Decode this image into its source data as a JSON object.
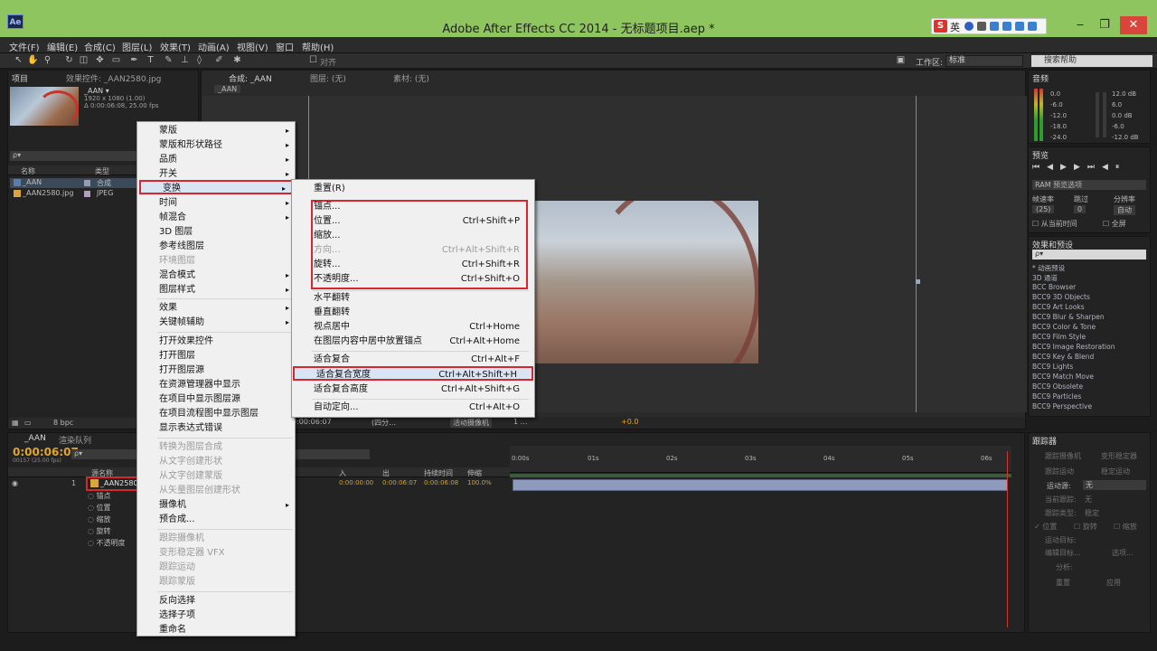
{
  "window": {
    "title": "Adobe After Effects CC 2014 - 无标题项目.aep *",
    "app_icon": "Ae"
  },
  "ime": {
    "logo": "S",
    "lang": "英"
  },
  "menubar": [
    "文件(F)",
    "编辑(E)",
    "合成(C)",
    "图层(L)",
    "效果(T)",
    "动画(A)",
    "视图(V)",
    "窗口",
    "帮助(H)"
  ],
  "toolbar": {
    "align_label": "对齐",
    "workspace_label": "工作区:",
    "workspace_value": "标准",
    "search_placeholder": "搜索帮助"
  },
  "project": {
    "tab_project": "项目",
    "tab_effects": "效果控件: _AAN2580.jpg",
    "comp_name": "_AAN ▾",
    "comp_info1": "1920 x 1080 (1.00)",
    "comp_info2": "Δ 0:00:06:08, 25.00 fps",
    "search": "ρ▾",
    "col_name": "名称",
    "col_type": "类型",
    "items": [
      {
        "name": "_AAN",
        "type": "合成"
      },
      {
        "name": "_AAN2580.jpg",
        "type": "JPEG"
      }
    ],
    "bpc": "8 bpc"
  },
  "comp": {
    "tab": "合成: _AAN",
    "tab_layer": "图层: (无)",
    "tab_footage": "素材: (无)",
    "subtab": "_AAN",
    "footer": {
      "time": "0:00:06:07",
      "view": "(四分…",
      "camera": "活动摄像机",
      "views": "1 …",
      "exposure": "+0.0"
    }
  },
  "audio": {
    "tab": "音频",
    "levels_left": [
      "0.0",
      "-6.0",
      "-12.0",
      "-18.0",
      "-24.0"
    ],
    "levels_right": [
      "12.0 dB",
      "6.0",
      "0.0 dB",
      "-6.0",
      "-12.0 dB"
    ]
  },
  "preview": {
    "tab": "预览",
    "ram": "RAM 预览选项",
    "fps_label": "帧速率",
    "skip_label": "跳过",
    "res_label": "分辨率",
    "fps": "(25)",
    "skip": "0",
    "res": "自动",
    "from_current": "从当前时间",
    "fullscreen": "全屏"
  },
  "effects": {
    "tab": "效果和预设",
    "items": [
      "* 动画预设",
      "3D 通道",
      "BCC Browser",
      "BCC9 3D Objects",
      "BCC9 Art Looks",
      "BCC9 Blur & Sharpen",
      "BCC9 Color & Tone",
      "BCC9 Film Style",
      "BCC9 Image Restoration",
      "BCC9 Key & Blend",
      "BCC9 Lights",
      "BCC9 Match Move",
      "BCC9 Obsolete",
      "BCC9 Particles",
      "BCC9 Perspective"
    ]
  },
  "tracker": {
    "tab": "跟踪器",
    "btn1": "跟踪摄像机",
    "btn2": "变形稳定器",
    "btn3": "跟踪运动",
    "btn4": "稳定运动",
    "source_label": "运动源:",
    "source_value": "无",
    "current_track": "当前跟踪:",
    "current_value": "无",
    "track_type": "跟踪类型:",
    "track_type_value": "稳定",
    "pos": "位置",
    "rot": "旋转",
    "scale": "缩放",
    "target": "运动目标:",
    "edit_target": "编辑目标...",
    "options": "选项...",
    "analyze": "分析:",
    "reset": "重置",
    "apply": "应用"
  },
  "timeline": {
    "tab_comp": "_AAN",
    "tab_render": "渲染队列",
    "timecode": "0:00:06:07",
    "fps": "00157 (25.00 fps)",
    "col_layer": "源名称",
    "col_in": "入",
    "col_out": "出",
    "col_duration": "持续时间",
    "col_stretch": "伸缩",
    "layer_index": "1",
    "layer_name": "_AAN2580",
    "layer_in": "0:00:00:00",
    "layer_out": "0:00:06:07",
    "layer_dur": "0:00:06:08",
    "layer_stretch": "100.0%",
    "props": [
      "锚点",
      "位置",
      "缩放",
      "旋转",
      "不透明度"
    ],
    "ruler": [
      "0:00s",
      "01s",
      "02s",
      "03s",
      "04s",
      "05s",
      "06s"
    ]
  },
  "context_menu": {
    "items": [
      {
        "label": "蒙版",
        "arrow": "▸"
      },
      {
        "label": "蒙版和形状路径",
        "arrow": "▸"
      },
      {
        "label": "品质",
        "arrow": "▸"
      },
      {
        "label": "开关",
        "arrow": "▸"
      },
      {
        "label": "变换",
        "arrow": "▸"
      },
      {
        "label": "时间",
        "arrow": "▸"
      },
      {
        "label": "帧混合",
        "arrow": "▸"
      },
      {
        "label": "3D 图层"
      },
      {
        "label": "参考线图层"
      },
      {
        "label": "环境图层"
      },
      {
        "label": "混合模式",
        "arrow": "▸"
      },
      {
        "label": "图层样式",
        "arrow": "▸"
      },
      {
        "label": "效果",
        "arrow": "▸"
      },
      {
        "label": "关键帧辅助",
        "arrow": "▸"
      },
      {
        "label": "打开效果控件"
      },
      {
        "label": "打开图层"
      },
      {
        "label": "打开图层源"
      },
      {
        "label": "在资源管理器中显示"
      },
      {
        "label": "在项目中显示图层源"
      },
      {
        "label": "在项目流程图中显示图层"
      },
      {
        "label": "显示表达式错误"
      },
      {
        "label": "转换为图层合成"
      },
      {
        "label": "从文字创建形状"
      },
      {
        "label": "从文字创建蒙版"
      },
      {
        "label": "从矢量图层创建形状"
      },
      {
        "label": "摄像机",
        "arrow": "▸"
      },
      {
        "label": "预合成..."
      },
      {
        "label": "跟踪摄像机"
      },
      {
        "label": "变形稳定器 VFX"
      },
      {
        "label": "跟踪运动"
      },
      {
        "label": "跟踪蒙版"
      },
      {
        "label": "反向选择"
      },
      {
        "label": "选择子项"
      },
      {
        "label": "重命名"
      }
    ]
  },
  "submenu": {
    "items": [
      {
        "label": "重置(R)",
        "shortcut": ""
      },
      {
        "label": "锚点...",
        "shortcut": ""
      },
      {
        "label": "位置...",
        "shortcut": "Ctrl+Shift+P"
      },
      {
        "label": "缩放...",
        "shortcut": ""
      },
      {
        "label": "方向...",
        "shortcut": "Ctrl+Alt+Shift+R"
      },
      {
        "label": "旋转...",
        "shortcut": "Ctrl+Shift+R"
      },
      {
        "label": "不透明度...",
        "shortcut": "Ctrl+Shift+O"
      },
      {
        "label": "水平翻转",
        "shortcut": ""
      },
      {
        "label": "垂直翻转",
        "shortcut": ""
      },
      {
        "label": "视点居中",
        "shortcut": "Ctrl+Home"
      },
      {
        "label": "在图层内容中居中放置锚点",
        "shortcut": "Ctrl+Alt+Home"
      },
      {
        "label": "适合复合",
        "shortcut": "Ctrl+Alt+F"
      },
      {
        "label": "适合复合宽度",
        "shortcut": "Ctrl+Alt+Shift+H"
      },
      {
        "label": "适合复合高度",
        "shortcut": "Ctrl+Alt+Shift+G"
      },
      {
        "label": "自动定向...",
        "shortcut": "Ctrl+Alt+O"
      }
    ]
  }
}
